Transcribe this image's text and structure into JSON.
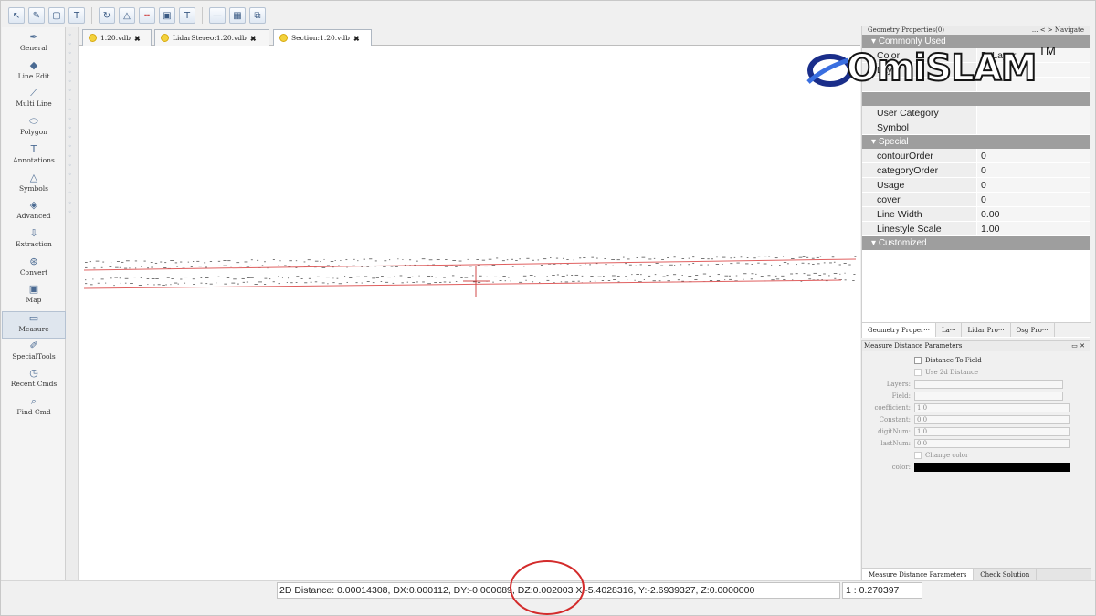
{
  "toolbar": {
    "icons": [
      "select-icon",
      "edit-node-icon",
      "rect-select-icon",
      "text-select-icon",
      "rotate-icon",
      "triangle-icon",
      "dash-line-icon",
      "box-icon",
      "text-icon",
      "line-icon",
      "grid-icon",
      "layers-icon"
    ]
  },
  "left_tools": [
    {
      "label": "General",
      "icon": "pen-icon"
    },
    {
      "label": "Line Edit",
      "icon": "line-edit-icon"
    },
    {
      "label": "Multi Line",
      "icon": "multi-line-icon"
    },
    {
      "label": "Polygon",
      "icon": "polygon-icon"
    },
    {
      "label": "Annotations",
      "icon": "text-t-icon"
    },
    {
      "label": "Symbols",
      "icon": "triangle-icon"
    },
    {
      "label": "Advanced",
      "icon": "diamond-icon"
    },
    {
      "label": "Extraction",
      "icon": "extraction-icon"
    },
    {
      "label": "Convert",
      "icon": "convert-icon"
    },
    {
      "label": "Map",
      "icon": "map-icon"
    },
    {
      "label": "Measure",
      "icon": "ruler-icon",
      "active": true
    },
    {
      "label": "SpecialTools",
      "icon": "wrench-icon"
    },
    {
      "label": "Recent Cmds",
      "icon": "clock-icon"
    },
    {
      "label": "Find Cmd",
      "icon": "find-icon"
    }
  ],
  "tabs": [
    {
      "label": "1.20.vdb",
      "close": "✖"
    },
    {
      "label": "LidarStereo:1.20.vdb",
      "close": "✖"
    },
    {
      "label": "Section:1.20.vdb",
      "close": "✖"
    }
  ],
  "geometry_panel": {
    "title": "Geometry Properties(0)",
    "title_extra": "...   <   >   Navigate",
    "sections": [
      {
        "name": "Commonly Used",
        "rows": [
          {
            "key": "Color",
            "value": "ByLayer"
          },
          {
            "key": "Layer",
            "value": ""
          },
          {
            "key": "",
            "value": ""
          }
        ]
      },
      {
        "name": "",
        "rows": [
          {
            "key": "User Category",
            "value": ""
          },
          {
            "key": "Symbol",
            "value": ""
          }
        ]
      },
      {
        "name": "Special",
        "rows": [
          {
            "key": "contourOrder",
            "value": "0"
          },
          {
            "key": "categoryOrder",
            "value": "0"
          },
          {
            "key": "Usage",
            "value": "0"
          },
          {
            "key": "cover",
            "value": "0"
          },
          {
            "key": "Line Width",
            "value": "0.00"
          },
          {
            "key": "Linestyle Scale",
            "value": "1.00"
          }
        ]
      },
      {
        "name": "Customized",
        "rows": []
      }
    ],
    "bottom_tabs": [
      "Geometry Proper···",
      "La···",
      "Lidar Pro···",
      "Osg Pro···"
    ]
  },
  "measure_panel": {
    "title": "Measure Distance Parameters",
    "distance_to_field": "Distance To Field",
    "use_2d": "Use 2d  Distance",
    "fields": [
      {
        "label": "Layers:",
        "value": ""
      },
      {
        "label": "Field:",
        "value": ""
      },
      {
        "label": "coefficient:",
        "value": "1.0"
      },
      {
        "label": "Constant:",
        "value": "0.0"
      },
      {
        "label": "digitNum:",
        "value": "1.0"
      },
      {
        "label": "lastNum:",
        "value": "0.0"
      }
    ],
    "change_color": "Change color",
    "color_label": "color:",
    "color_value": "#000000",
    "bottom_tabs": [
      "Measure Distance Parameters",
      "Check Solution"
    ]
  },
  "status": {
    "measure_text": "2D Distance: 0.00014308, DX:0.000112, DY:-0.000089, DZ:0.002003  X:-5.4028316, Y:-2.6939327, Z:0.0000000",
    "scale": "1 : 0.270397"
  },
  "logo": {
    "text": "OmiSLAM",
    "tm": "TM"
  },
  "colors": {
    "section_header": "#9e9e9e",
    "tab_dot": "#f3d23c",
    "highlight_circle": "#d32b2b",
    "profile_line": "#e06060"
  }
}
